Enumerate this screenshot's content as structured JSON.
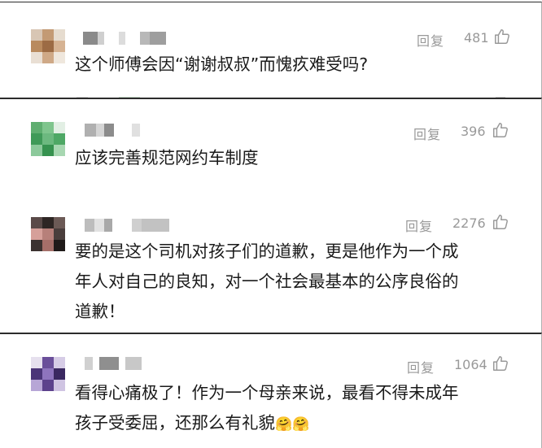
{
  "comments": [
    {
      "reply": "回复",
      "likes": "481",
      "lines": [
        "这个师傅会因“谢谢叔叔”而愧疚难受吗?"
      ]
    },
    {
      "reply": "回复",
      "likes": "396",
      "lines": [
        "应该完善规范网约车制度"
      ]
    },
    {
      "reply": "回复",
      "likes": "2276",
      "lines": [
        "要的是这个司机对孩子们的道歉，更是他作为一个成",
        "年人对自己的良知，对一个社会最基本的公序良俗的",
        "道歉！"
      ]
    },
    {
      "reply": "回复",
      "likes": "1064",
      "lines": [
        "看得心痛极了！作为一个母亲来说，最看不得未成年",
        "孩子受委屈，还那么有礼貌"
      ],
      "emoji": "🤗🤗"
    }
  ],
  "colors": {
    "text": "#1a1a1a",
    "muted": "#999999",
    "divider": "#2b2b2b"
  },
  "icons": {
    "like": "thumb-up-icon",
    "emoji": "hugging-face-emoji"
  }
}
